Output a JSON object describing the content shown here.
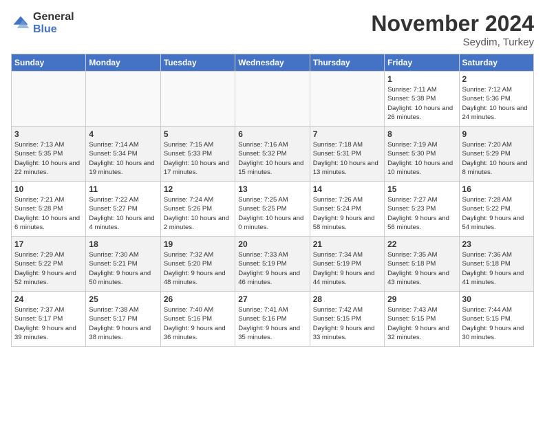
{
  "header": {
    "logo_general": "General",
    "logo_blue": "Blue",
    "title": "November 2024",
    "subtitle": "Seydim, Turkey"
  },
  "days_of_week": [
    "Sunday",
    "Monday",
    "Tuesday",
    "Wednesday",
    "Thursday",
    "Friday",
    "Saturday"
  ],
  "weeks": [
    [
      {
        "num": "",
        "info": ""
      },
      {
        "num": "",
        "info": ""
      },
      {
        "num": "",
        "info": ""
      },
      {
        "num": "",
        "info": ""
      },
      {
        "num": "",
        "info": ""
      },
      {
        "num": "1",
        "info": "Sunrise: 7:11 AM\nSunset: 5:38 PM\nDaylight: 10 hours\nand 26 minutes."
      },
      {
        "num": "2",
        "info": "Sunrise: 7:12 AM\nSunset: 5:36 PM\nDaylight: 10 hours\nand 24 minutes."
      }
    ],
    [
      {
        "num": "3",
        "info": "Sunrise: 7:13 AM\nSunset: 5:35 PM\nDaylight: 10 hours\nand 22 minutes."
      },
      {
        "num": "4",
        "info": "Sunrise: 7:14 AM\nSunset: 5:34 PM\nDaylight: 10 hours\nand 19 minutes."
      },
      {
        "num": "5",
        "info": "Sunrise: 7:15 AM\nSunset: 5:33 PM\nDaylight: 10 hours\nand 17 minutes."
      },
      {
        "num": "6",
        "info": "Sunrise: 7:16 AM\nSunset: 5:32 PM\nDaylight: 10 hours\nand 15 minutes."
      },
      {
        "num": "7",
        "info": "Sunrise: 7:18 AM\nSunset: 5:31 PM\nDaylight: 10 hours\nand 13 minutes."
      },
      {
        "num": "8",
        "info": "Sunrise: 7:19 AM\nSunset: 5:30 PM\nDaylight: 10 hours\nand 10 minutes."
      },
      {
        "num": "9",
        "info": "Sunrise: 7:20 AM\nSunset: 5:29 PM\nDaylight: 10 hours\nand 8 minutes."
      }
    ],
    [
      {
        "num": "10",
        "info": "Sunrise: 7:21 AM\nSunset: 5:28 PM\nDaylight: 10 hours\nand 6 minutes."
      },
      {
        "num": "11",
        "info": "Sunrise: 7:22 AM\nSunset: 5:27 PM\nDaylight: 10 hours\nand 4 minutes."
      },
      {
        "num": "12",
        "info": "Sunrise: 7:24 AM\nSunset: 5:26 PM\nDaylight: 10 hours\nand 2 minutes."
      },
      {
        "num": "13",
        "info": "Sunrise: 7:25 AM\nSunset: 5:25 PM\nDaylight: 10 hours\nand 0 minutes."
      },
      {
        "num": "14",
        "info": "Sunrise: 7:26 AM\nSunset: 5:24 PM\nDaylight: 9 hours\nand 58 minutes."
      },
      {
        "num": "15",
        "info": "Sunrise: 7:27 AM\nSunset: 5:23 PM\nDaylight: 9 hours\nand 56 minutes."
      },
      {
        "num": "16",
        "info": "Sunrise: 7:28 AM\nSunset: 5:22 PM\nDaylight: 9 hours\nand 54 minutes."
      }
    ],
    [
      {
        "num": "17",
        "info": "Sunrise: 7:29 AM\nSunset: 5:22 PM\nDaylight: 9 hours\nand 52 minutes."
      },
      {
        "num": "18",
        "info": "Sunrise: 7:30 AM\nSunset: 5:21 PM\nDaylight: 9 hours\nand 50 minutes."
      },
      {
        "num": "19",
        "info": "Sunrise: 7:32 AM\nSunset: 5:20 PM\nDaylight: 9 hours\nand 48 minutes."
      },
      {
        "num": "20",
        "info": "Sunrise: 7:33 AM\nSunset: 5:19 PM\nDaylight: 9 hours\nand 46 minutes."
      },
      {
        "num": "21",
        "info": "Sunrise: 7:34 AM\nSunset: 5:19 PM\nDaylight: 9 hours\nand 44 minutes."
      },
      {
        "num": "22",
        "info": "Sunrise: 7:35 AM\nSunset: 5:18 PM\nDaylight: 9 hours\nand 43 minutes."
      },
      {
        "num": "23",
        "info": "Sunrise: 7:36 AM\nSunset: 5:18 PM\nDaylight: 9 hours\nand 41 minutes."
      }
    ],
    [
      {
        "num": "24",
        "info": "Sunrise: 7:37 AM\nSunset: 5:17 PM\nDaylight: 9 hours\nand 39 minutes."
      },
      {
        "num": "25",
        "info": "Sunrise: 7:38 AM\nSunset: 5:17 PM\nDaylight: 9 hours\nand 38 minutes."
      },
      {
        "num": "26",
        "info": "Sunrise: 7:40 AM\nSunset: 5:16 PM\nDaylight: 9 hours\nand 36 minutes."
      },
      {
        "num": "27",
        "info": "Sunrise: 7:41 AM\nSunset: 5:16 PM\nDaylight: 9 hours\nand 35 minutes."
      },
      {
        "num": "28",
        "info": "Sunrise: 7:42 AM\nSunset: 5:15 PM\nDaylight: 9 hours\nand 33 minutes."
      },
      {
        "num": "29",
        "info": "Sunrise: 7:43 AM\nSunset: 5:15 PM\nDaylight: 9 hours\nand 32 minutes."
      },
      {
        "num": "30",
        "info": "Sunrise: 7:44 AM\nSunset: 5:15 PM\nDaylight: 9 hours\nand 30 minutes."
      }
    ]
  ]
}
